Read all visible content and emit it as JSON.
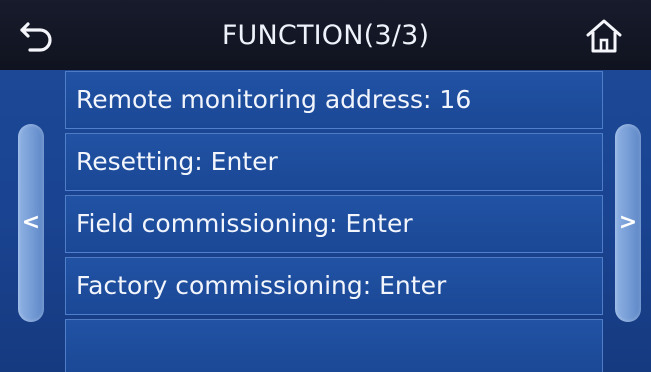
{
  "header": {
    "title": "FUNCTION(3/3)",
    "back_icon": "back-arrow-icon",
    "home_icon": "home-icon"
  },
  "menu": {
    "items": [
      {
        "label": "Remote monitoring address: 16"
      },
      {
        "label": "Resetting: Enter"
      },
      {
        "label": "Field commissioning: Enter"
      },
      {
        "label": "Factory commissioning: Enter"
      },
      {
        "label": ""
      }
    ]
  },
  "nav": {
    "prev_symbol": "<",
    "next_symbol": ">"
  },
  "colors": {
    "background": "#1a4492",
    "topbar": "#12162a",
    "row_border": "#78a5eb",
    "handle": "#7aa0d8"
  }
}
